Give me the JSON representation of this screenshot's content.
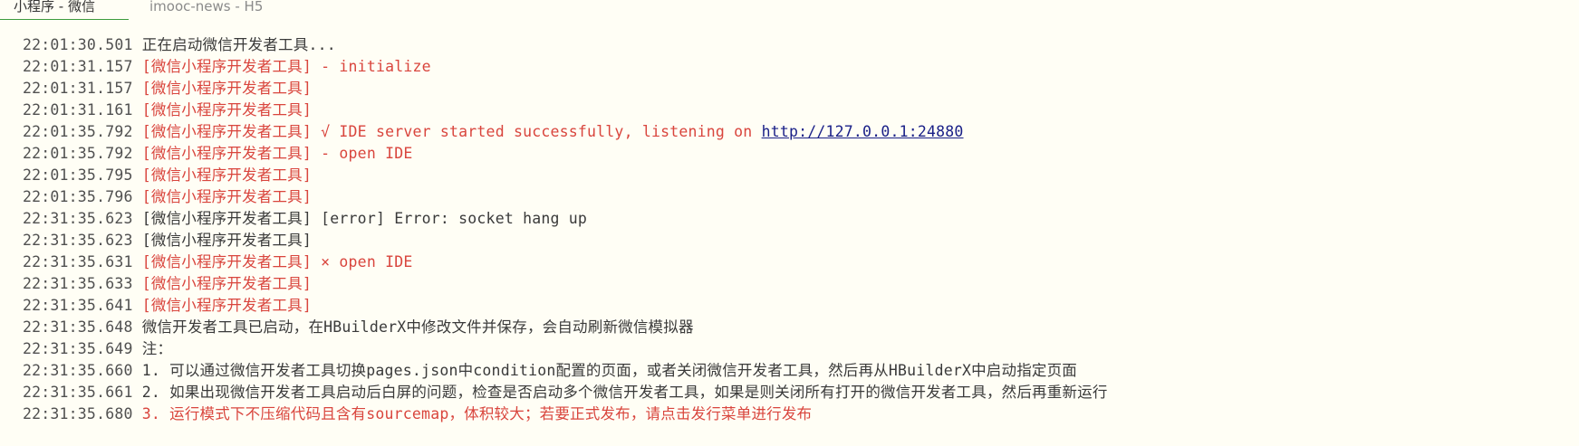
{
  "tabs": [
    {
      "label": "小程序 - 微信",
      "active": true
    },
    {
      "label": "imooc-news - H5",
      "active": false
    }
  ],
  "colors": {
    "default_text": "#3a3a3a",
    "error_text": "#d9453d",
    "link": "#1a2088",
    "active_tab_underline": "#3c9c3c",
    "background": "#fffef5"
  },
  "console": {
    "lines": [
      {
        "time": "22:01:30.501",
        "text": "正在启动微信开发者工具...",
        "color": "default"
      },
      {
        "time": "22:01:31.157",
        "text": "[微信小程序开发者工具] - initialize",
        "color": "red"
      },
      {
        "time": "22:01:31.157",
        "text": "[微信小程序开发者工具]",
        "color": "red"
      },
      {
        "time": "22:01:31.161",
        "text": "[微信小程序开发者工具]",
        "color": "red"
      },
      {
        "time": "22:01:35.792",
        "text": "[微信小程序开发者工具] √ IDE server started successfully, listening on ",
        "link": "http://127.0.0.1:24880",
        "color": "red"
      },
      {
        "time": "22:01:35.792",
        "text": "[微信小程序开发者工具] - open IDE",
        "color": "red"
      },
      {
        "time": "22:01:35.795",
        "text": "[微信小程序开发者工具]",
        "color": "red"
      },
      {
        "time": "22:01:35.796",
        "text": "[微信小程序开发者工具]",
        "color": "red"
      },
      {
        "time": "22:31:35.623",
        "text": "[微信小程序开发者工具] [error] Error: socket hang up",
        "color": "default"
      },
      {
        "time": "22:31:35.623",
        "text": "[微信小程序开发者工具]",
        "color": "default"
      },
      {
        "time": "22:31:35.631",
        "text": "[微信小程序开发者工具] × open IDE",
        "color": "red"
      },
      {
        "time": "22:31:35.633",
        "text": "[微信小程序开发者工具]",
        "color": "red"
      },
      {
        "time": "22:31:35.641",
        "text": "[微信小程序开发者工具]",
        "color": "red"
      },
      {
        "time": "22:31:35.648",
        "text": "微信开发者工具已启动，在HBuilderX中修改文件并保存，会自动刷新微信模拟器",
        "color": "default"
      },
      {
        "time": "22:31:35.649",
        "text": "注：",
        "color": "default"
      },
      {
        "time": "22:31:35.660",
        "text": "1. 可以通过微信开发者工具切换pages.json中condition配置的页面，或者关闭微信开发者工具，然后再从HBuilderX中启动指定页面",
        "color": "default"
      },
      {
        "time": "22:31:35.661",
        "text": "2. 如果出现微信开发者工具启动后白屏的问题，检查是否启动多个微信开发者工具，如果是则关闭所有打开的微信开发者工具，然后再重新运行",
        "color": "default"
      },
      {
        "time": "22:31:35.680",
        "text": "3. 运行模式下不压缩代码且含有sourcemap，体积较大；若要正式发布，请点击发行菜单进行发布",
        "color": "red"
      }
    ]
  }
}
